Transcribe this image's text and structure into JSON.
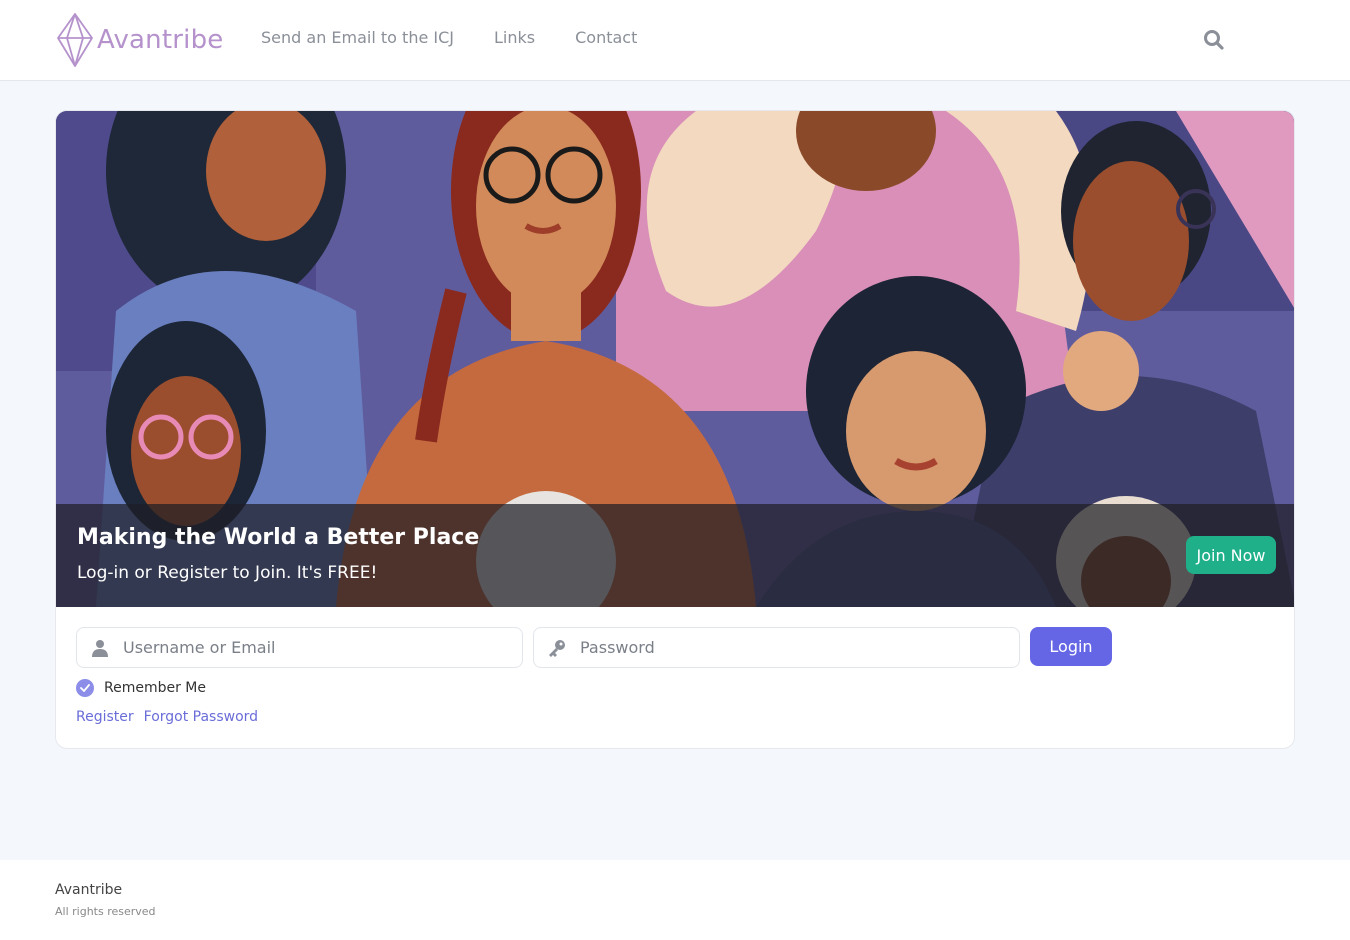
{
  "header": {
    "brand": "Avantribe",
    "nav": [
      {
        "label": "Send an Email to the ICJ"
      },
      {
        "label": "Links"
      },
      {
        "label": "Contact"
      }
    ],
    "search_icon": "search-icon"
  },
  "hero": {
    "title": "Making the World a Better Place",
    "subtitle": "Log-in or Register to Join. It's FREE!",
    "join_label": "Join Now"
  },
  "login": {
    "username_placeholder": "Username or Email",
    "password_placeholder": "Password",
    "login_label": "Login",
    "remember_label": "Remember Me",
    "remember_checked": true,
    "register_label": "Register",
    "forgot_label": "Forgot Password"
  },
  "footer": {
    "name": "Avantribe",
    "rights": "All rights reserved"
  },
  "colors": {
    "brand": "#b592cc",
    "primary": "#6466e6",
    "join": "#1fb08a",
    "link": "#6a6dd8"
  }
}
